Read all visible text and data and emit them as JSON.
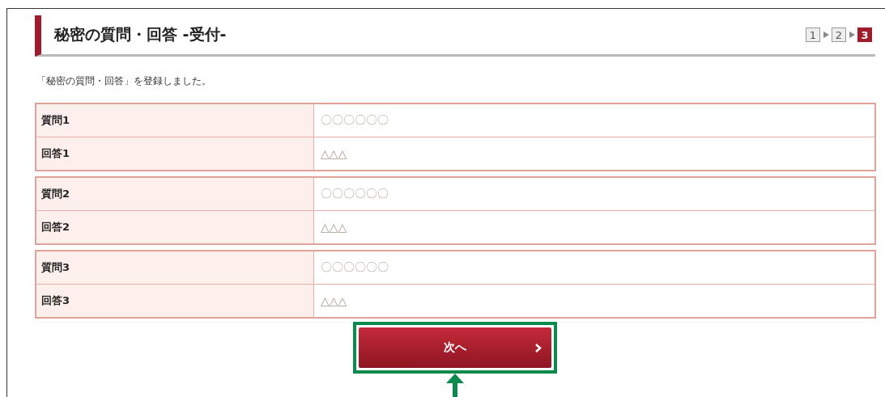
{
  "title": "秘密の質問・回答 -受付-",
  "steps": [
    {
      "label": "1",
      "selected": false
    },
    {
      "label": "2",
      "selected": false
    },
    {
      "label": "3",
      "selected": true
    }
  ],
  "message": "「秘密の質問・回答」を登録しました。",
  "groups": [
    {
      "rows": [
        {
          "label": "質問1",
          "value": "〇〇〇〇〇〇"
        },
        {
          "label": "回答1",
          "value": "△△△"
        }
      ]
    },
    {
      "rows": [
        {
          "label": "質問2",
          "value": "〇〇〇〇〇〇"
        },
        {
          "label": "回答2",
          "value": "△△△"
        }
      ]
    },
    {
      "rows": [
        {
          "label": "質問3",
          "value": "〇〇〇〇〇〇"
        },
        {
          "label": "回答3",
          "value": "△△△"
        }
      ]
    }
  ],
  "next_button": {
    "label": "次へ",
    "highlighted": true
  }
}
